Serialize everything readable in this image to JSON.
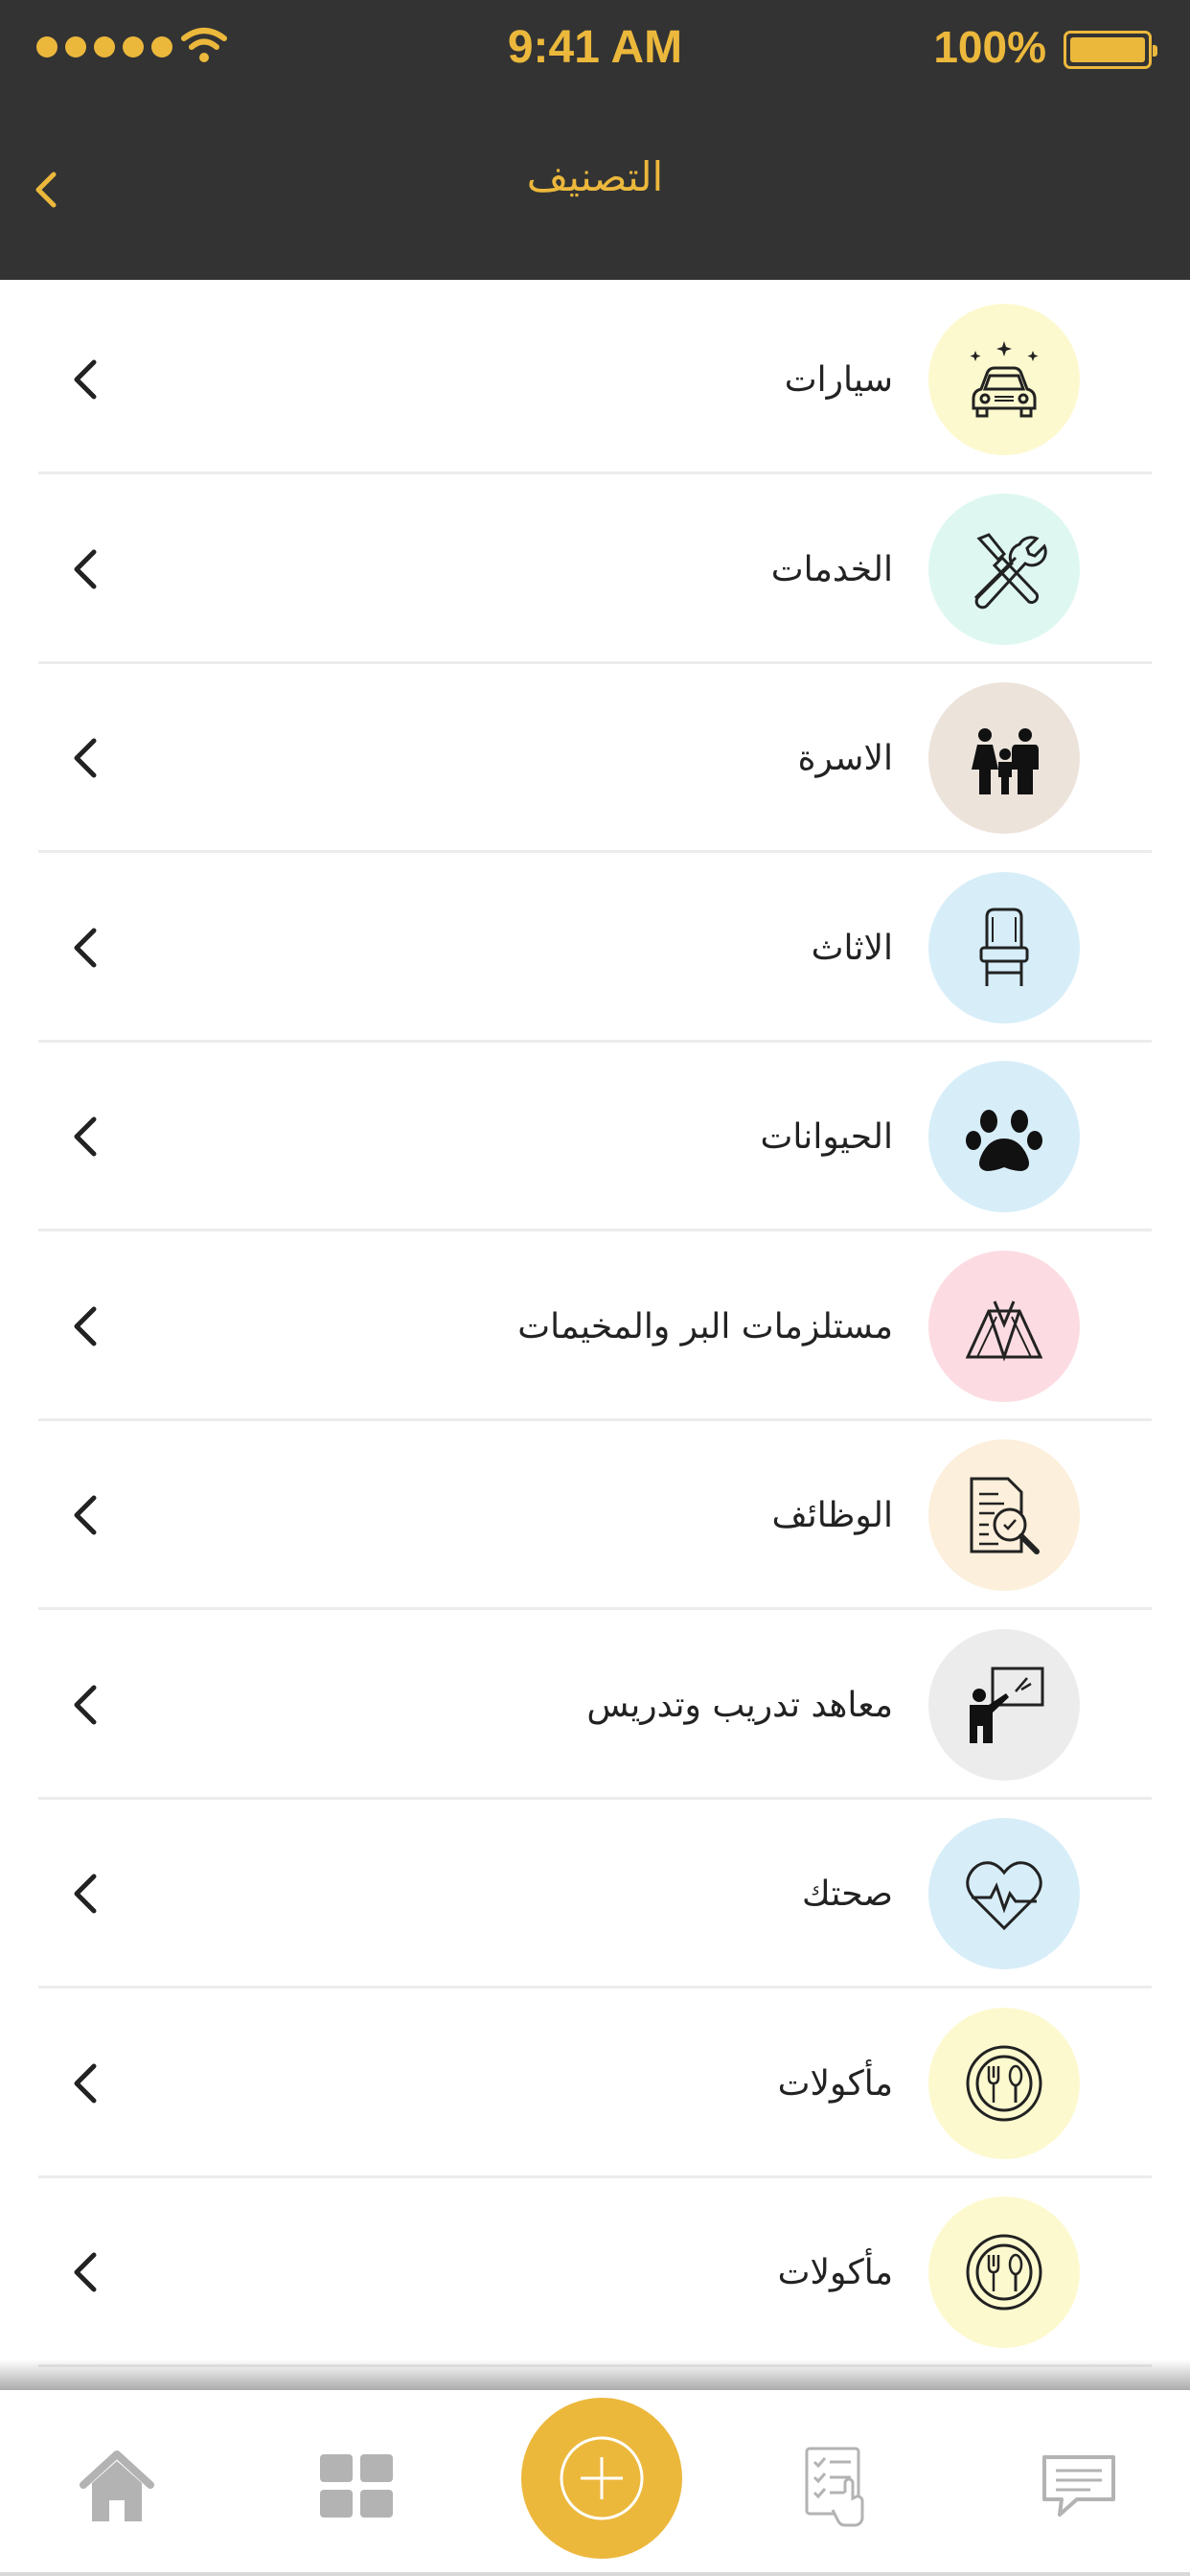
{
  "status_bar": {
    "time": "9:41 AM",
    "battery": "100%",
    "signal_icon": "signal-dots-icon",
    "wifi_icon": "wifi-icon",
    "battery_icon": "battery-icon"
  },
  "header": {
    "title": "التصنيف",
    "back_icon": "chevron-left-icon"
  },
  "categories": [
    {
      "label": "سيارات",
      "icon": "car-icon",
      "bg": "#fdf9cf"
    },
    {
      "label": "الخدمات",
      "icon": "tools-icon",
      "bg": "#def8f1"
    },
    {
      "label": "الاسرة",
      "icon": "family-icon",
      "bg": "#ece3db"
    },
    {
      "label": "الاثاث",
      "icon": "chair-icon",
      "bg": "#d7eef9"
    },
    {
      "label": "الحيوانات",
      "icon": "paw-icon",
      "bg": "#d7eef9"
    },
    {
      "label": "مستلزمات البر والمخيمات",
      "icon": "tent-icon",
      "bg": "#fcdce2"
    },
    {
      "label": "الوظائف",
      "icon": "job-document-icon",
      "bg": "#fcefdb"
    },
    {
      "label": "معاهد تدريب وتدريس",
      "icon": "teacher-icon",
      "bg": "#ececec"
    },
    {
      "label": "صحتك",
      "icon": "heart-pulse-icon",
      "bg": "#d7eef9"
    },
    {
      "label": "مأكولات",
      "icon": "dining-icon",
      "bg": "#fdf9cf"
    },
    {
      "label": "مأكولات",
      "icon": "dining-icon",
      "bg": "#fdf9cf"
    }
  ],
  "tab_bar": {
    "items": [
      "home-icon",
      "grid-icon",
      "add-icon",
      "checklist-icon",
      "chat-icon"
    ],
    "accent": "#ecb83c",
    "inactive": "#b3b3b3"
  }
}
